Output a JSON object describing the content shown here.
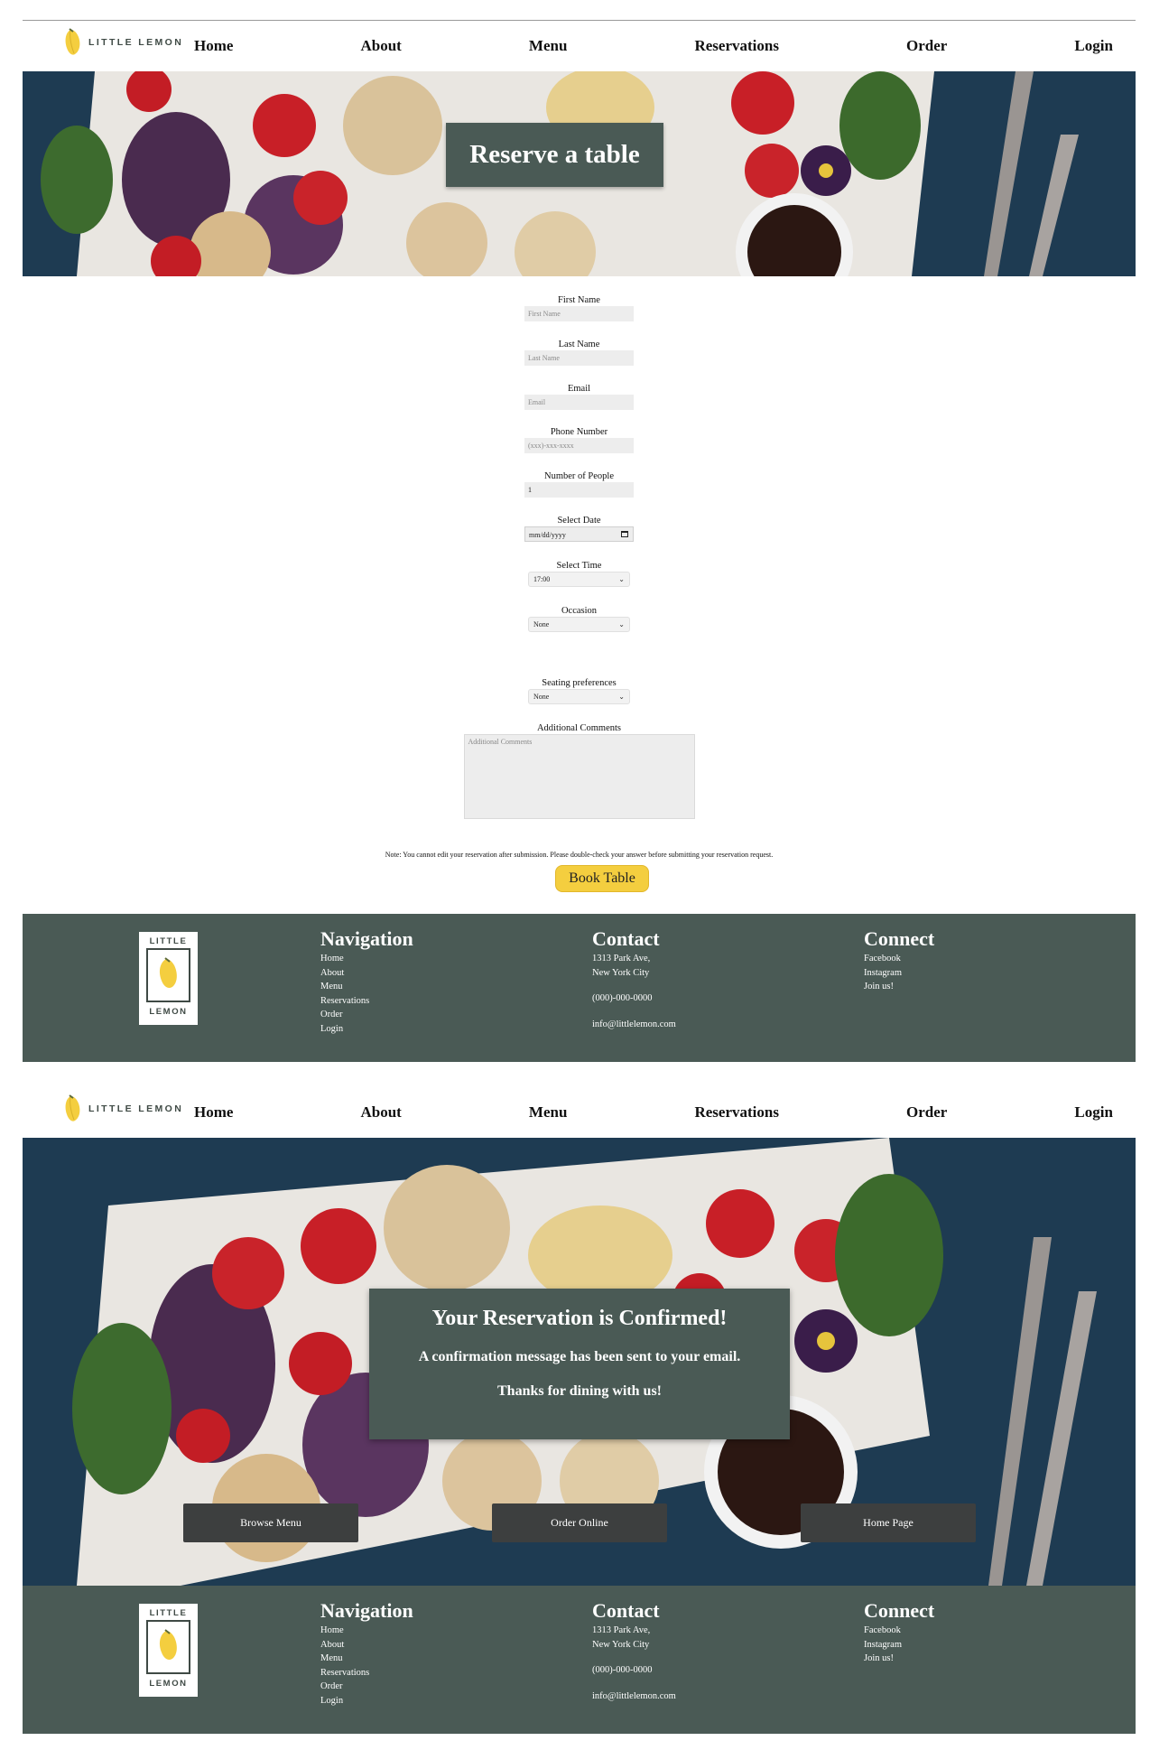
{
  "brand": {
    "name": "LITTLE LEMON",
    "logo_top": "LITTLE",
    "logo_bottom": "LEMON"
  },
  "nav": {
    "items": [
      "Home",
      "About",
      "Menu",
      "Reservations",
      "Order",
      "Login"
    ]
  },
  "hero": {
    "title": "Reserve a table"
  },
  "form": {
    "first_name": {
      "label": "First Name",
      "placeholder": "First Name"
    },
    "last_name": {
      "label": "Last Name",
      "placeholder": "Last Name"
    },
    "email": {
      "label": "Email",
      "placeholder": "Email"
    },
    "phone": {
      "label": "Phone Number",
      "placeholder": "(xxx)-xxx-xxxx"
    },
    "people": {
      "label": "Number of People",
      "value": "1"
    },
    "date": {
      "label": "Select Date",
      "value": "mm/dd/yyyy"
    },
    "time": {
      "label": "Select Time",
      "value": "17:00"
    },
    "occasion": {
      "label": "Occasion",
      "value": "None"
    },
    "seating": {
      "label": "Seating preferences",
      "value": "None"
    },
    "comments": {
      "label": "Additional Comments",
      "placeholder": "Additional Comments"
    },
    "note": "Note: You cannot edit your reservation after submission. Please double-check your answer before submitting your reservation request.",
    "submit": "Book Table"
  },
  "footer": {
    "navigation": {
      "title": "Navigation",
      "items": [
        "Home",
        "About",
        "Menu",
        "Reservations",
        "Order",
        "Login"
      ]
    },
    "contact": {
      "title": "Contact",
      "address1": "1313 Park Ave,",
      "address2": "New York City",
      "phone": "(000)-000-0000",
      "email": "info@littlelemon.com"
    },
    "connect": {
      "title": "Connect",
      "items": [
        "Facebook",
        "Instagram",
        "Join us!"
      ]
    }
  },
  "confirmation": {
    "title": "Your Reservation is Confirmed!",
    "message": "A confirmation message has been sent to your email.",
    "thanks": "Thanks for dining with us!",
    "buttons": [
      "Browse Menu",
      "Order Online",
      "Home Page"
    ]
  },
  "colors": {
    "accent": "#f4ce3f",
    "panel": "#4a5a55",
    "dark_button": "#3d3f3f"
  }
}
